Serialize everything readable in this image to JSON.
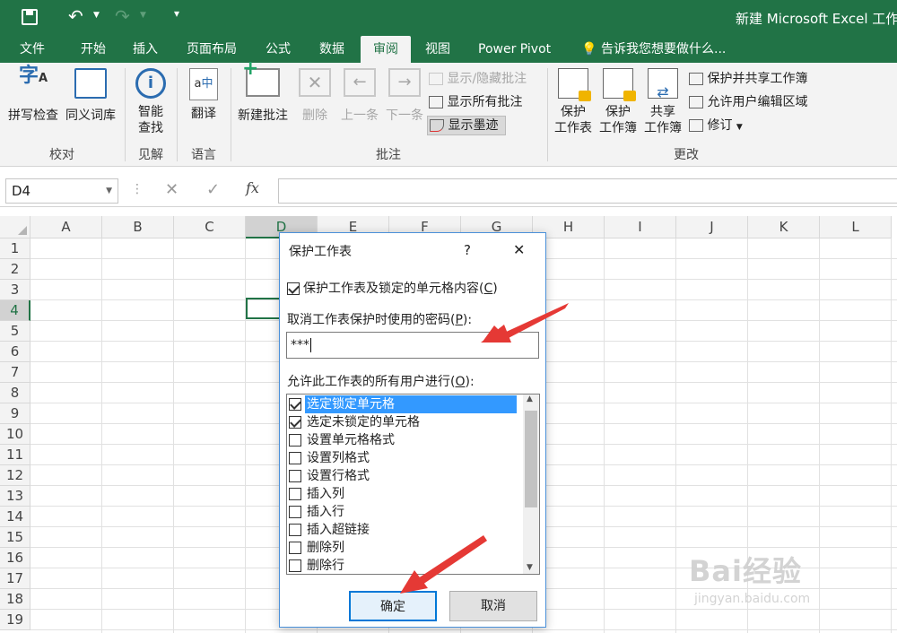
{
  "window": {
    "title": "新建 Microsoft Excel 工作"
  },
  "ribbon_tabs": [
    "文件",
    "开始",
    "插入",
    "页面布局",
    "公式",
    "数据",
    "审阅",
    "视图",
    "Power Pivot"
  ],
  "active_tab": "审阅",
  "tell_me": "告诉我您想要做什么...",
  "ribbon": {
    "proofing": {
      "spell": "拼写检查",
      "thesaurus": "同义词库",
      "group": "校对"
    },
    "insights": {
      "smart_l1": "智能",
      "smart_l2": "查找",
      "group": "见解"
    },
    "language": {
      "translate": "翻译",
      "group": "语言"
    },
    "comments": {
      "new": "新建批注",
      "delete": "删除",
      "prev": "上一条",
      "next": "下一条",
      "show_hide": "显示/隐藏批注",
      "show_all": "显示所有批注",
      "show_ink": "显示墨迹",
      "group": "批注"
    },
    "changes": {
      "protect_sheet_l1": "保护",
      "protect_sheet_l2": "工作表",
      "protect_wb_l1": "保护",
      "protect_wb_l2": "工作簿",
      "share_wb_l1": "共享",
      "share_wb_l2": "工作簿",
      "protect_share": "保护并共享工作簿",
      "allow_edit": "允许用户编辑区域",
      "track": "修订",
      "group": "更改"
    }
  },
  "formula_bar": {
    "name_box": "D4",
    "fx": "fx"
  },
  "columns": [
    "A",
    "B",
    "C",
    "D",
    "E",
    "F",
    "G",
    "H",
    "I",
    "J",
    "K",
    "L"
  ],
  "rows": [
    "1",
    "2",
    "3",
    "4",
    "5",
    "6",
    "7",
    "8",
    "9",
    "10",
    "11",
    "12",
    "13",
    "14",
    "15",
    "16",
    "17",
    "18",
    "19"
  ],
  "dialog": {
    "title": "保护工作表",
    "help": "?",
    "close": "✕",
    "protect_label": "保护工作表及锁定的单元格内容(",
    "protect_key": "C",
    "password_label": "取消工作表保护时使用的密码(",
    "password_key": "P",
    "password_value": "***",
    "allow_label": "允许此工作表的所有用户进行(",
    "allow_key": "O",
    "permissions": [
      {
        "label": "选定锁定单元格",
        "checked": true
      },
      {
        "label": "选定未锁定的单元格",
        "checked": true
      },
      {
        "label": "设置单元格格式",
        "checked": false
      },
      {
        "label": "设置列格式",
        "checked": false
      },
      {
        "label": "设置行格式",
        "checked": false
      },
      {
        "label": "插入列",
        "checked": false
      },
      {
        "label": "插入行",
        "checked": false
      },
      {
        "label": "插入超链接",
        "checked": false
      },
      {
        "label": "删除列",
        "checked": false
      },
      {
        "label": "删除行",
        "checked": false
      }
    ],
    "ok": "确定",
    "cancel": "取消"
  },
  "watermark": {
    "brand": "Bai经验",
    "url": "jingyan.baidu.com"
  },
  "colors": {
    "excel_green": "#217346",
    "arrow_red": "#e53935",
    "selection_blue": "#3399ff"
  }
}
